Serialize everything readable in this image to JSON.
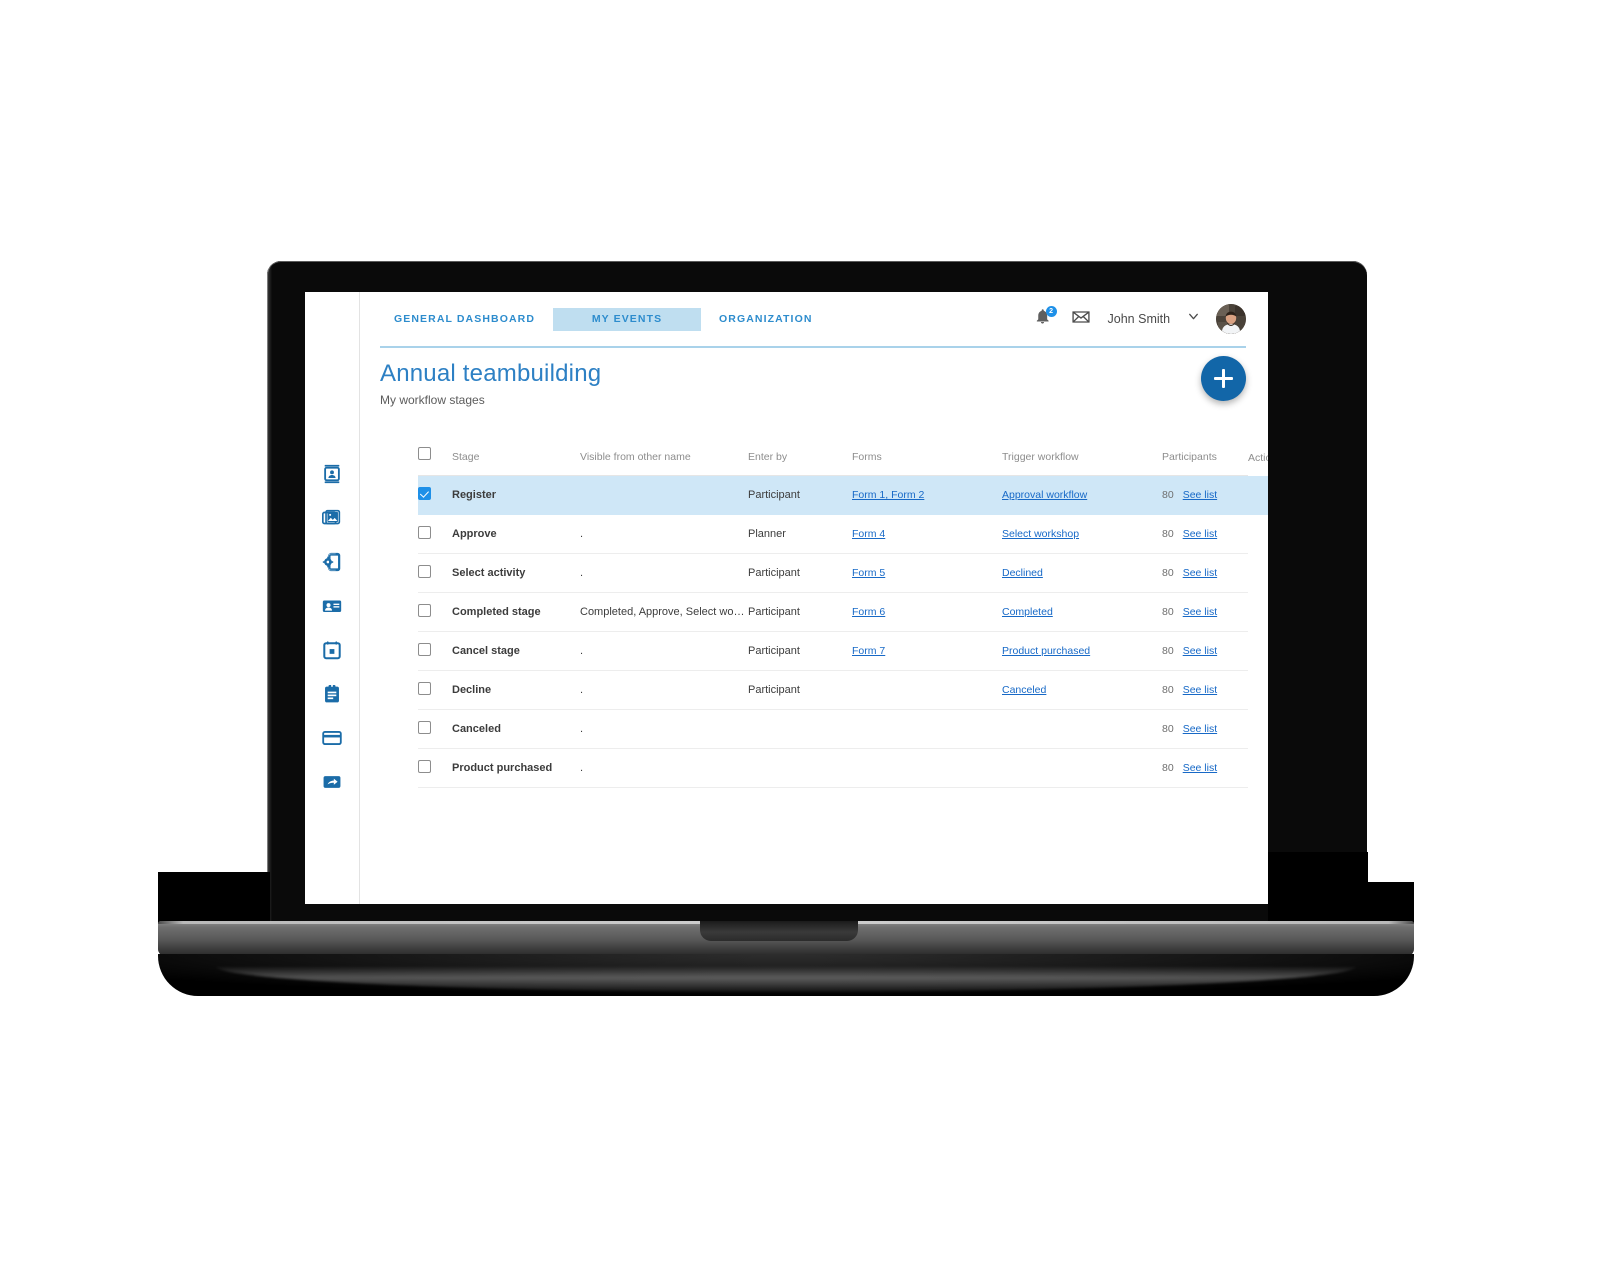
{
  "app": {
    "logo_name": "company-logo"
  },
  "topbar": {
    "tabs": [
      {
        "label": "GENERAL DASHBOARD",
        "active": false
      },
      {
        "label": "MY EVENTS",
        "active": true
      },
      {
        "label": "ORGANIZATION",
        "active": false
      }
    ],
    "notifications_badge": "2",
    "notifications_icon": "bell-icon",
    "messages_icon": "envelope-icon",
    "username": "John Smith",
    "caret_icon": "chevron-down-icon",
    "avatar_name": "user-avatar"
  },
  "page": {
    "title": "Annual teambuilding",
    "subtitle": "My workflow stages",
    "add_button_icon": "plus-icon"
  },
  "sidebar": {
    "items": [
      {
        "icon": "contact-card-icon",
        "label": "Contacts"
      },
      {
        "icon": "photo-gallery-icon",
        "label": "Gallery"
      },
      {
        "icon": "device-settings-icon",
        "label": "Device settings"
      },
      {
        "icon": "id-badge-icon",
        "label": "Badges"
      },
      {
        "icon": "calendar-icon",
        "label": "Calendar"
      },
      {
        "icon": "clipboard-icon",
        "label": "Tasks"
      },
      {
        "icon": "credit-card-icon",
        "label": "Payments"
      },
      {
        "icon": "share-arrow-icon",
        "label": "Share"
      }
    ]
  },
  "table": {
    "columns": [
      "Stage",
      "Visible from other name",
      "Enter by",
      "Forms",
      "Trigger workflow",
      "Participants",
      "Actions"
    ],
    "select_all_checked": false,
    "rows": [
      {
        "checked": true,
        "selected": true,
        "drag_handle": false,
        "stage": "Register",
        "visible_from": "",
        "enter_by": "Participant",
        "forms": "Form 1, Form 2",
        "trigger": "Approval workflow",
        "participants": "80",
        "participants_link": "See list"
      },
      {
        "checked": false,
        "selected": false,
        "drag_handle": true,
        "stage": "Approve",
        "visible_from": ".",
        "enter_by": "Planner",
        "forms": "Form 4",
        "trigger": "Select workshop",
        "participants": "80",
        "participants_link": "See list"
      },
      {
        "checked": false,
        "selected": false,
        "drag_handle": false,
        "stage": "Select activity",
        "visible_from": ".",
        "enter_by": "Participant",
        "forms": "Form 5",
        "trigger": "Declined",
        "participants": "80",
        "participants_link": "See list"
      },
      {
        "checked": false,
        "selected": false,
        "drag_handle": false,
        "stage": "Completed stage",
        "visible_from": "Completed, Approve, Select workshop",
        "enter_by": "Participant",
        "forms": "Form 6",
        "trigger": "Completed",
        "participants": "80",
        "participants_link": "See list"
      },
      {
        "checked": false,
        "selected": false,
        "drag_handle": false,
        "stage": "Cancel stage",
        "visible_from": ".",
        "enter_by": "Participant",
        "forms": "Form 7",
        "trigger": "Product purchased",
        "participants": "80",
        "participants_link": "See list"
      },
      {
        "checked": false,
        "selected": false,
        "drag_handle": false,
        "stage": "Decline",
        "visible_from": ".",
        "enter_by": "Participant",
        "forms": "",
        "trigger": "Canceled",
        "participants": "80",
        "participants_link": "See list"
      },
      {
        "checked": false,
        "selected": false,
        "drag_handle": false,
        "stage": "Canceled",
        "visible_from": ".",
        "enter_by": "",
        "forms": "",
        "trigger": "",
        "participants": "80",
        "participants_link": "See list"
      },
      {
        "checked": false,
        "selected": false,
        "drag_handle": false,
        "stage": "Product purchased",
        "visible_from": ".",
        "enter_by": "",
        "forms": "",
        "trigger": "",
        "participants": "80",
        "participants_link": "See list"
      }
    ]
  },
  "colors": {
    "brand_blue": "#1266a8",
    "link_blue": "#1769c7",
    "tab_blue": "#2d8ccd",
    "tab_active_bg": "#bfdef0",
    "row_selected_bg": "#cfe7f7",
    "title_blue": "#2d80c4",
    "rail_icon_blue": "#1b6ca8"
  }
}
